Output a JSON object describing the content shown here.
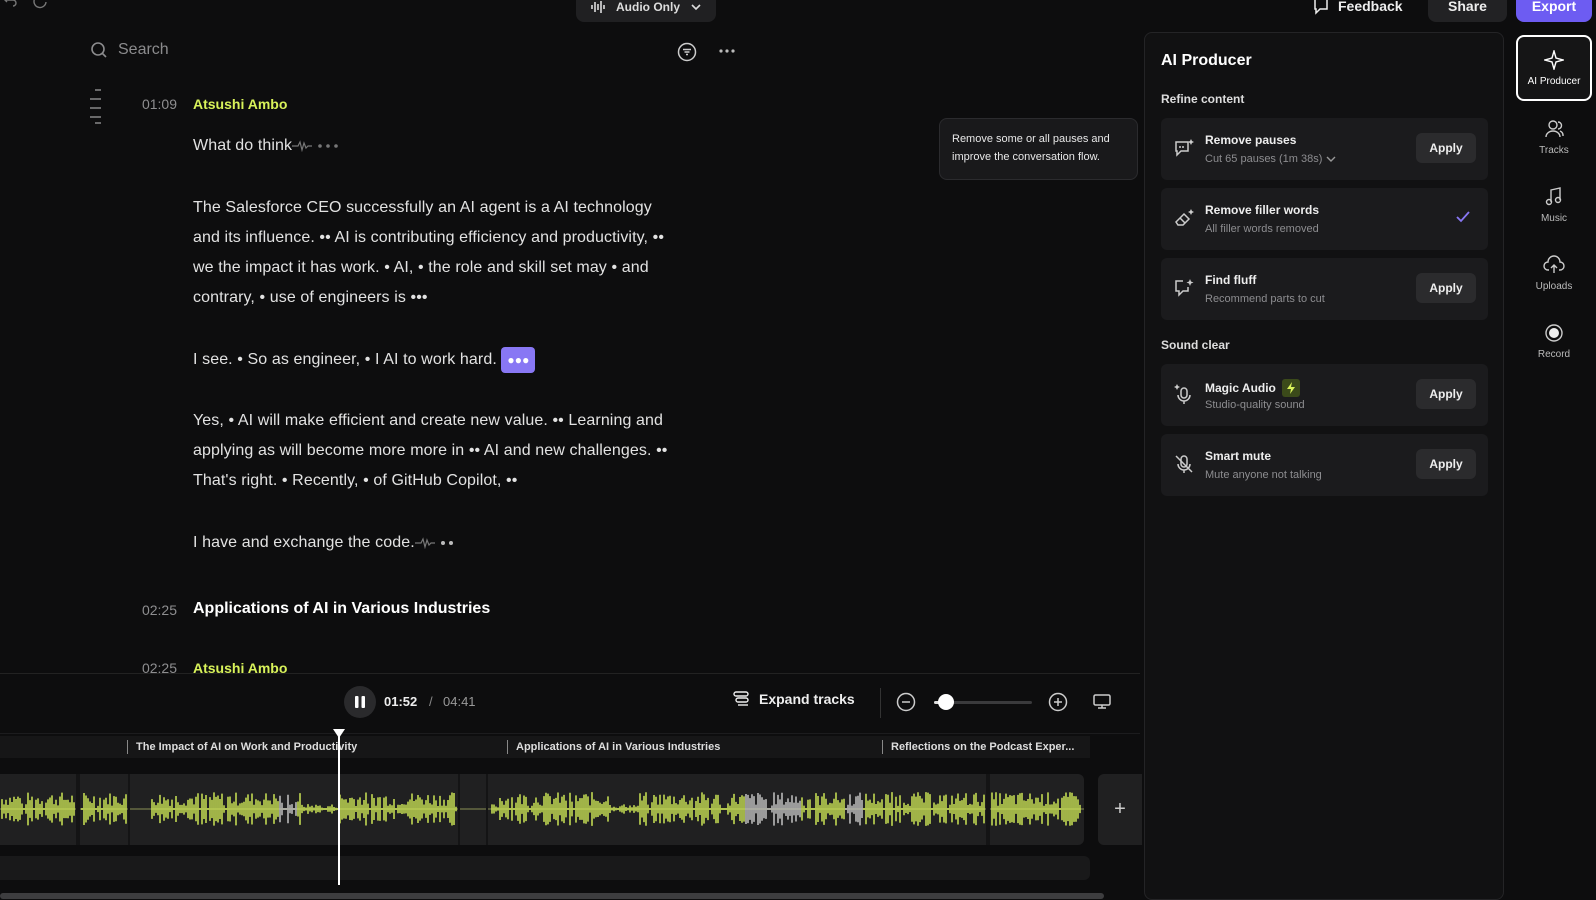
{
  "topbar": {
    "mode_label": "Audio Only",
    "feedback_label": "Feedback",
    "share_label": "Share",
    "export_label": "Export"
  },
  "transcript": {
    "search_placeholder": "Search",
    "blocks": [
      {
        "time": "01:09",
        "speaker": "Atsushi Ambo",
        "paragraphs": [
          "What do think",
          "The Salesforce CEO successfully an AI agent is a AI technology and its influence. •• AI is contributing efficiency and productivity, •• we the impact it has work. • AI, • the role and skill set may • and contrary, • use of engineers is •••",
          "I see. • So as engineer, • I AI to work hard.",
          "Yes, • AI will make efficient and create new value. •• Learning and applying as will become more more in •• AI and new challenges. •• That's right. • Recently, • of GitHub Copilot, ••",
          "I have and exchange the code."
        ]
      }
    ],
    "chapter": {
      "time": "02:25",
      "title": "Applications of AI in Various Industries"
    },
    "next_block": {
      "time": "02:25",
      "speaker": "Atsushi Ambo"
    }
  },
  "tooltip": {
    "text": "Remove some or all pauses and improve the conversation flow."
  },
  "player": {
    "current_time": "01:52",
    "separator": "/",
    "total_time": "04:41",
    "expand_label": "Expand tracks",
    "zoom_level": 0.12
  },
  "timeline": {
    "chapters": [
      "The Impact of AI on Work and Productivity",
      "Applications of AI in Various Industries",
      "Reflections on the Podcast Exper..."
    ],
    "add_label": "+",
    "playhead_fraction": 0.398
  },
  "panel": {
    "title": "AI Producer",
    "refine_title": "Refine content",
    "refine_items": [
      {
        "title": "Remove pauses",
        "subtitle": "Cut 65 pauses (1m 38s)",
        "action": "Apply",
        "icon": "pause-bubble-icon"
      },
      {
        "title": "Remove filler words",
        "subtitle": "All filler words removed",
        "action": "done",
        "icon": "eraser-sparkle-icon"
      },
      {
        "title": "Find fluff",
        "subtitle": "Recommend parts to cut",
        "action": "Apply",
        "icon": "chat-sparkle-icon"
      }
    ],
    "sound_title": "Sound clear",
    "sound_items": [
      {
        "title": "Magic Audio",
        "subtitle": "Studio-quality sound",
        "action": "Apply",
        "icon": "magic-mic-icon"
      },
      {
        "title": "Smart mute",
        "subtitle": "Mute anyone not talking",
        "action": "Apply",
        "icon": "mic-off-icon"
      }
    ]
  },
  "rail": {
    "items": [
      {
        "label": "AI Producer",
        "icon": "sparkle-icon"
      },
      {
        "label": "Tracks",
        "icon": "people-icon"
      },
      {
        "label": "Music",
        "icon": "music-note-icon"
      },
      {
        "label": "Uploads",
        "icon": "upload-cloud-icon"
      },
      {
        "label": "Record",
        "icon": "record-icon"
      }
    ]
  },
  "colors": {
    "accent": "#6d5cf2",
    "speaker": "#d8f25a",
    "waveform": "#d8f25a",
    "waveform_muted": "#cfcfcf"
  }
}
